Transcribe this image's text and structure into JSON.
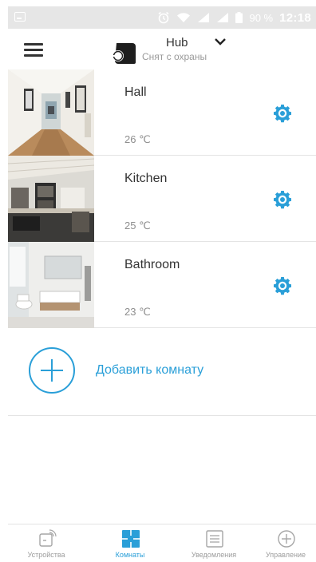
{
  "status_bar": {
    "battery": "90 %",
    "time": "12:18"
  },
  "header": {
    "hub_name": "Hub",
    "hub_status": "Снят с охраны"
  },
  "rooms": [
    {
      "name": "Hall",
      "temperature": "26 ℃"
    },
    {
      "name": "Kitchen",
      "temperature": "25 ℃"
    },
    {
      "name": "Bathroom",
      "temperature": "23 ℃"
    }
  ],
  "add_room": {
    "label": "Добавить комнату"
  },
  "bottom_nav": [
    {
      "label": "Устройства",
      "icon": "devices-icon"
    },
    {
      "label": "Комнаты",
      "icon": "rooms-icon",
      "active": true
    },
    {
      "label": "Уведомления",
      "icon": "notifications-icon"
    },
    {
      "label": "Управление",
      "icon": "control-icon"
    }
  ],
  "colors": {
    "accent": "#2a9fd8",
    "text": "#333333",
    "muted": "#8e8e8e",
    "status_bar": "#e6e6e6"
  }
}
